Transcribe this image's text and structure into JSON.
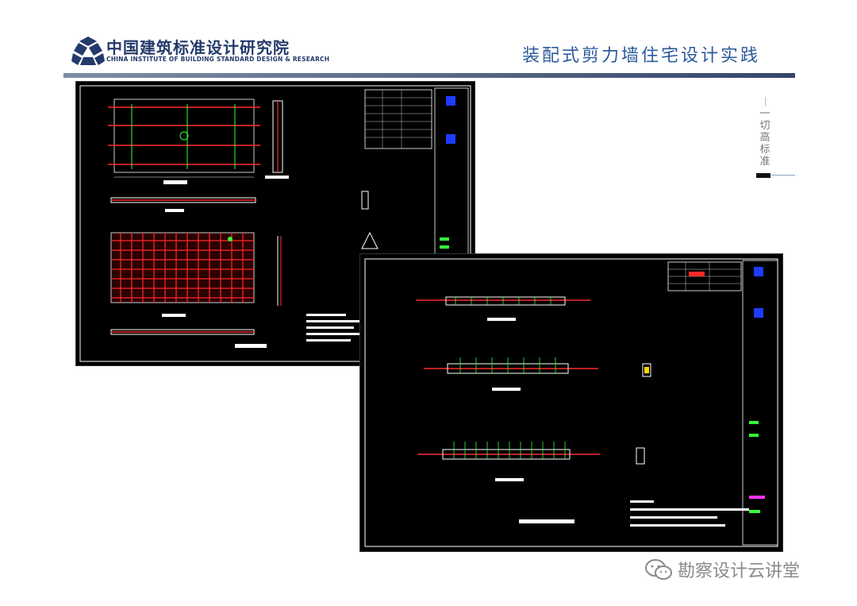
{
  "header": {
    "logo_cn": "中国建筑标准设计研究院",
    "logo_en": "CHINA INSTITUTE OF BUILDING STANDARD DESIGN & RESEARCH",
    "title": "装配式剪力墙住宅设计实践"
  },
  "side": {
    "vertical_text": "一切高标准"
  },
  "watermark": {
    "text": "勘察设计云讲堂"
  },
  "colors": {
    "brand": "#243a6b",
    "title": "#2c5a9a",
    "cad_bg": "#000000",
    "cad_white": "#ffffff",
    "cad_red": "#ff2a2a",
    "cad_green": "#34ff3a",
    "cad_blue": "#1e3cff"
  }
}
